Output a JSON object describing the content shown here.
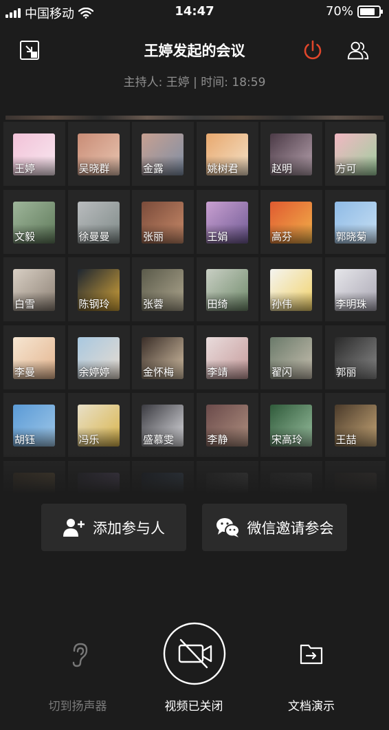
{
  "status_bar": {
    "carrier": "中国移动",
    "time": "14:47",
    "battery": "70%",
    "battery_level": 0.7
  },
  "header": {
    "title": "王婷发起的会议",
    "subtitle": "主持人: 王婷 | 时间: 18:59",
    "icons": [
      "minimize-window-icon",
      "power-icon",
      "participants-icon"
    ]
  },
  "participants": [
    {
      "name": "王婷",
      "colors": [
        "#f2c2d8",
        "#f8e8f0"
      ]
    },
    {
      "name": "吴晓群",
      "colors": [
        "#c98c76",
        "#e9c6b2"
      ]
    },
    {
      "name": "金露",
      "colors": [
        "#c7a091",
        "#7e8fa6"
      ]
    },
    {
      "name": "姚树君",
      "colors": [
        "#e8a86e",
        "#f4e2c8"
      ]
    },
    {
      "name": "赵明",
      "colors": [
        "#4b3a46",
        "#b9a4b0"
      ]
    },
    {
      "name": "方可",
      "colors": [
        "#f1b7c2",
        "#9ecf9f"
      ]
    },
    {
      "name": "文毅",
      "colors": [
        "#9eb59a",
        "#5f7a5a"
      ]
    },
    {
      "name": "徐曼曼",
      "colors": [
        "#b9bcbe",
        "#7f8a88"
      ]
    },
    {
      "name": "张丽",
      "colors": [
        "#7a4b3a",
        "#c98b6a"
      ]
    },
    {
      "name": "王娟",
      "colors": [
        "#c9a0d1",
        "#6f5a94"
      ]
    },
    {
      "name": "高芬",
      "colors": [
        "#e05a30",
        "#f2b24b"
      ]
    },
    {
      "name": "郭晓菊",
      "colors": [
        "#8fbbe6",
        "#c7dff3"
      ]
    },
    {
      "name": "白雪",
      "colors": [
        "#d8cfc4",
        "#8c8074"
      ]
    },
    {
      "name": "陈钢玲",
      "colors": [
        "#1d2530",
        "#d9a83a"
      ]
    },
    {
      "name": "张蓉",
      "colors": [
        "#5a5a4a",
        "#b0a890"
      ]
    },
    {
      "name": "田绮",
      "colors": [
        "#c9cfc4",
        "#6f8a6a"
      ]
    },
    {
      "name": "孙伟",
      "colors": [
        "#f4f4f0",
        "#f2d268"
      ]
    },
    {
      "name": "李明珠",
      "colors": [
        "#e6e6ea",
        "#a9a6b3"
      ]
    },
    {
      "name": "李曼",
      "colors": [
        "#f6e6d2",
        "#e3b48e"
      ]
    },
    {
      "name": "余婷婷",
      "colors": [
        "#a8c8e0",
        "#e8dcd0"
      ]
    },
    {
      "name": "金怀梅",
      "colors": [
        "#3a2e28",
        "#d8c4a8"
      ]
    },
    {
      "name": "李靖",
      "colors": [
        "#e9dcdc",
        "#c59a9a"
      ]
    },
    {
      "name": "翟闪",
      "colors": [
        "#6a7a6a",
        "#c8c0b0"
      ]
    },
    {
      "name": "郭丽",
      "colors": [
        "#2a2a2a",
        "#8a8a8a"
      ]
    },
    {
      "name": "胡钰",
      "colors": [
        "#5a9ad6",
        "#a0c8e8"
      ]
    },
    {
      "name": "冯乐",
      "colors": [
        "#e8e0c8",
        "#d9b44a"
      ]
    },
    {
      "name": "盛慕雯",
      "colors": [
        "#3a3a40",
        "#e0e0e4"
      ]
    },
    {
      "name": "李静",
      "colors": [
        "#6a4a4a",
        "#b09080"
      ]
    },
    {
      "name": "宋高玲",
      "colors": [
        "#2f5a3a",
        "#9ac0a0"
      ]
    },
    {
      "name": "王喆",
      "colors": [
        "#4a3a2a",
        "#c8a878"
      ]
    },
    {
      "name": "",
      "colors": [
        "#3a3228",
        "#6a5a40"
      ]
    },
    {
      "name": "",
      "colors": [
        "#2a2a30",
        "#6a5a7a"
      ]
    },
    {
      "name": "",
      "colors": [
        "#20242c",
        "#4a5a6a"
      ]
    },
    {
      "name": "",
      "colors": [
        "#2a2a2a",
        "#5a5a5a"
      ]
    },
    {
      "name": "",
      "colors": [
        "#2c2c2c",
        "#4a4a4a"
      ]
    },
    {
      "name": "",
      "colors": [
        "#2a2826",
        "#4a4440"
      ]
    }
  ],
  "actions": {
    "add_participant": "添加参与人",
    "wechat_invite": "微信邀请参会"
  },
  "bottom_bar": {
    "speaker": "切到扬声器",
    "video": "视频已关闭",
    "doc": "文档演示"
  },
  "colors": {
    "background": "#1c1c1c",
    "tile": "#262626",
    "power": "#e0462b",
    "muted_text": "#8f8f8f"
  }
}
